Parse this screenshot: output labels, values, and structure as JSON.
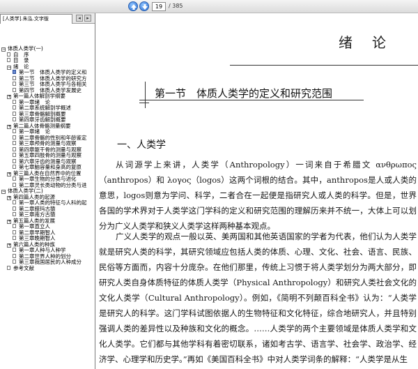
{
  "toolbar": {
    "current_page": "19",
    "total_pages": "/ 385",
    "prev_icon": "up-arrow-icon",
    "next_icon": "down-arrow-icon"
  },
  "sidebar": {
    "tab_label": "[人类学].朱泓.文字版",
    "tree": [
      {
        "level": 0,
        "kind": "node",
        "expander": "−",
        "label": "体质人类学(一)"
      },
      {
        "level": 1,
        "kind": "leaf",
        "label": "自　序"
      },
      {
        "level": 1,
        "kind": "leaf",
        "label": "目　录"
      },
      {
        "level": 1,
        "kind": "node",
        "expander": "−",
        "label": "绪　论"
      },
      {
        "level": 2,
        "kind": "leaf",
        "current": true,
        "label": "第一节　体质人类学的定义和"
      },
      {
        "level": 2,
        "kind": "leaf",
        "label": "第二节　体质人类学的研究方"
      },
      {
        "level": 2,
        "kind": "leaf",
        "label": "第三节　体质人类学与各相关"
      },
      {
        "level": 2,
        "kind": "leaf",
        "label": "第四节　体质人类学发展史"
      },
      {
        "level": 1,
        "kind": "node",
        "expander": "+",
        "label": "第一篇人体解剖学纲要"
      },
      {
        "level": 2,
        "kind": "leaf",
        "label": "第一章绪　论"
      },
      {
        "level": 2,
        "kind": "leaf",
        "label": "第二章系统解剖学概述"
      },
      {
        "level": 2,
        "kind": "leaf",
        "label": "第三章骨骼解剖概要"
      },
      {
        "level": 2,
        "kind": "leaf",
        "label": "第四章牙齿解剖概要"
      },
      {
        "level": 1,
        "kind": "node",
        "expander": "+",
        "label": "第二篇人体骨骼测量纲要"
      },
      {
        "level": 2,
        "kind": "leaf",
        "label": "第一章绪　论"
      },
      {
        "level": 2,
        "kind": "leaf",
        "label": "第二章骨骼的性别和年龄鉴定"
      },
      {
        "level": 2,
        "kind": "leaf",
        "label": "第三章颅骨的测量与观察"
      },
      {
        "level": 2,
        "kind": "leaf",
        "label": "第四章躯干骨的测量与观察"
      },
      {
        "level": 2,
        "kind": "leaf",
        "label": "第五章四肢骨的测量与观察"
      },
      {
        "level": 2,
        "kind": "leaf",
        "label": "第六章牙齿的测量与观察"
      },
      {
        "level": 2,
        "kind": "leaf",
        "label": "第七章脑容量和身高的复原"
      },
      {
        "level": 1,
        "kind": "node",
        "expander": "+",
        "label": "第三篇人类在自然界中的位置"
      },
      {
        "level": 2,
        "kind": "leaf",
        "label": "第一章生物的分类与进化"
      },
      {
        "level": 2,
        "kind": "leaf",
        "label": "第二章灵长类动物的分类与进"
      },
      {
        "level": 0,
        "kind": "node",
        "expander": "−",
        "label": "体质人类学(二)"
      },
      {
        "level": 1,
        "kind": "node",
        "expander": "+",
        "label": "第四篇人类的起源"
      },
      {
        "level": 2,
        "kind": "leaf",
        "label": "第一章人类的特征与人科的起"
      },
      {
        "level": 2,
        "kind": "leaf",
        "label": "第二章腊玛古猿"
      },
      {
        "level": 2,
        "kind": "leaf",
        "label": "第三章南方古猿"
      },
      {
        "level": 1,
        "kind": "node",
        "expander": "+",
        "label": "第五篇人类的发展"
      },
      {
        "level": 2,
        "kind": "leaf",
        "label": "第一章直立人"
      },
      {
        "level": 2,
        "kind": "leaf",
        "label": "第二章早期智人"
      },
      {
        "level": 2,
        "kind": "leaf",
        "label": "第三章晚期智人"
      },
      {
        "level": 1,
        "kind": "node",
        "expander": "+",
        "label": "第六篇人类的种族"
      },
      {
        "level": 2,
        "kind": "leaf",
        "label": "第一章人种与人种学"
      },
      {
        "level": 2,
        "kind": "leaf",
        "label": "第二章世界人种的划分"
      },
      {
        "level": 2,
        "kind": "leaf",
        "label": "第三章我国居民的人种成分"
      },
      {
        "level": 1,
        "kind": "leaf",
        "label": "参考文献"
      }
    ]
  },
  "document": {
    "chapter_title": "绪论",
    "section_title": "第一节　体质人类学的定义和研究范围",
    "subsection_title": "一、人类学",
    "paragraphs": [
      "从词源学上来讲，人类学（Anthropology）一词来自于希腊文 ανθρωπος（anthropos）和 λογος（logos）这两个词根的结合。其中，anthropos是人或人类的意思，logos则意为学问、科学，二者合在一起便是指研究人或人类的科学。但是，世界各国的学术界对于人类学这门学科的定义和研究范围的理解历来并不统一，大体上可以划分为广义人类学和狭义人类学这样两种基本观点。",
      "广义人类学的观点一般以英、美两国和其他英语国家的学者为代表，他们认为人类学就是研究人类的科学，其研究领域应包括人类的体质、心理、文化、社会、语言、民族、民俗等方面而，内容十分庞杂。在他们那里，传统上习惯于将人类学划分为两大部分，即研究人类自身体质特征的体质人类学（Physical Anthropology）和研究人类社会文化的文化人类学（Cultural Anthropology）。例如，《简明不列颠百科全书》认为：“人类学是研究人的科学。这门学科试图依据人的生物特征和文化特征，综合地研究人，并且特别强调人类的差异性以及种族和文化的概念。……人类学的两个主要领域是体质人类学和文化人类学。它们都与其他学科有着密切联系，诸如考古学、语言学、社会学、政治学、经济学、心理学和历史学。”再如《美国百科全书》中对人类学词条的解释：“人类学是从生"
    ]
  }
}
